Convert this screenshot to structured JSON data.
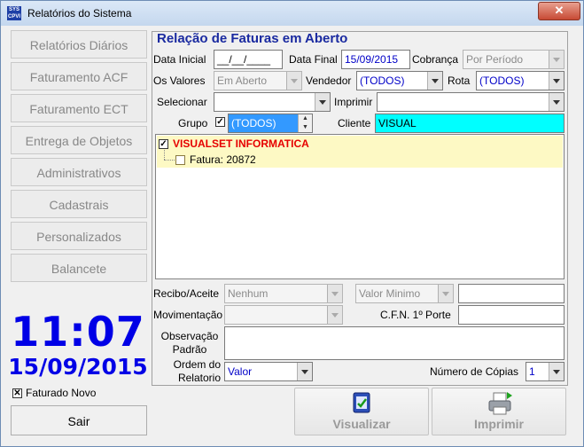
{
  "window": {
    "title": "Relatórios do Sistema",
    "icon_text": "SYS CPVI"
  },
  "sidebar": {
    "items": [
      {
        "label": "Relatórios Diários"
      },
      {
        "label": "Faturamento ACF"
      },
      {
        "label": "Faturamento ECT"
      },
      {
        "label": "Entrega de Objetos"
      },
      {
        "label": "Administrativos"
      },
      {
        "label": "Cadastrais"
      },
      {
        "label": "Personalizados"
      },
      {
        "label": "Balancete"
      }
    ],
    "clock_time": "11:07",
    "clock_date": "15/09/2015",
    "faturado_novo_label": "Faturado Novo",
    "faturado_novo_checked": "✕",
    "sair_label": "Sair"
  },
  "form": {
    "heading": "Relação de Faturas em Aberto",
    "data_inicial_label": "Data Inicial",
    "data_inicial_value": "__/__/____",
    "data_final_label": "Data Final",
    "data_final_value": "15/09/2015",
    "cobranca_label": "Cobrança",
    "cobranca_value": "Por Período",
    "os_valores_label": "Os Valores",
    "os_valores_value": "Em Aberto",
    "vendedor_label": "Vendedor",
    "vendedor_value": "(TODOS)",
    "rota_label": "Rota",
    "rota_value": "(TODOS)",
    "selecionar_label": "Selecionar",
    "selecionar_value": "",
    "imprimir_label": "Imprimir",
    "imprimir_value": "",
    "grupo_label": "Grupo",
    "grupo_checked": "✓",
    "grupo_value": "(TODOS)",
    "cliente_label": "Cliente",
    "cliente_value": "VISUAL",
    "tree": {
      "parent": "VISUALSET INFORMATICA",
      "parent_checked": "✓",
      "child": "Fatura: 20872"
    },
    "recibo_label": "Recibo/Aceite",
    "recibo_value": "Nenhum",
    "valor_minimo_value": "Valor Minimo",
    "valor_minimo_amount": "",
    "movimentacao_label": "Movimentação",
    "movimentacao_value": "",
    "cfn_label": "C.F.N. 1º Porte",
    "cfn_value": "",
    "observacao_label": "Observação Padrão",
    "observacao_value": "",
    "ordem_label": "Ordem do Relatorio",
    "ordem_value": "Valor",
    "copias_label": "Número de Cópias",
    "copias_value": "1"
  },
  "actions": {
    "visualizar_label": "Visualizar",
    "imprimir_label": "Imprimir"
  },
  "colors": {
    "heading": "#1a2aa0",
    "clock": "#0000e6",
    "cliente_bg": "#00ffff",
    "tree_selection": "#fdf9c4",
    "tree_parent": "#e60000"
  }
}
